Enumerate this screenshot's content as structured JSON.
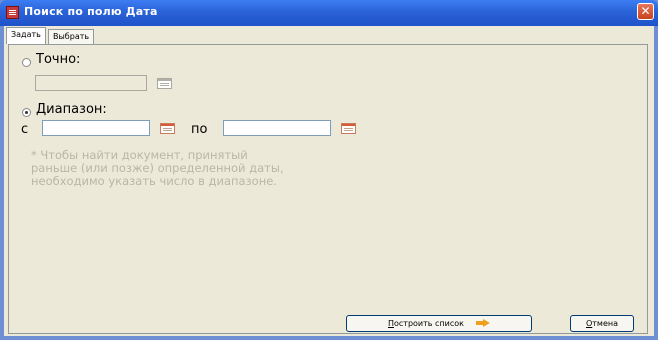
{
  "window": {
    "title": "Поиск по полю Дата",
    "close_symbol": "✕"
  },
  "tabs": [
    {
      "label": "Задать",
      "active": true
    },
    {
      "label": "Выбрать из словаря",
      "active": false
    }
  ],
  "exact": {
    "label": "Точно:",
    "selected": false,
    "value": "",
    "icon": "calendar-icon"
  },
  "range": {
    "label": "Диапазон:",
    "selected": true,
    "from_label": "с",
    "from_value": "",
    "to_label": "по",
    "to_value": "",
    "icon": "calendar-icon"
  },
  "note": "* Чтобы найти документ, принятый\nраньше (или позже) определенной даты,\nнеобходимо указать число в диапазоне.",
  "buttons": {
    "build_first": "П",
    "build_rest": "остроить список",
    "build_icon": "arrow-right-icon",
    "cancel_first": "О",
    "cancel_rest": "тмена"
  },
  "colors": {
    "titlebar": "#2a62d8",
    "dialog_bg": "#ece9d8",
    "note_text": "#b9b6a8",
    "arrow": "#f0a020"
  }
}
